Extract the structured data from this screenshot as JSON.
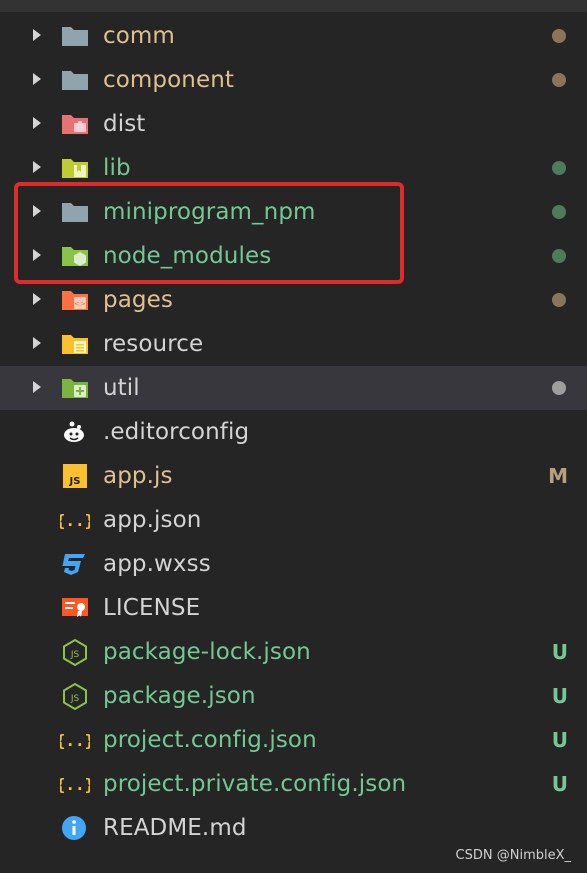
{
  "colors": {
    "background": "#252526",
    "modified": "#e2c08d",
    "untracked": "#73c991",
    "normal": "#d4d4d4",
    "highlight": "#e02b2b"
  },
  "explorer": {
    "folders": [
      {
        "name": "comm",
        "icon": "folder-icon",
        "status": "modified",
        "dot": "#8b7559"
      },
      {
        "name": "component",
        "icon": "folder-icon",
        "status": "modified",
        "dot": "#8b7559"
      },
      {
        "name": "dist",
        "icon": "folder-dist-icon",
        "status": "normal"
      },
      {
        "name": "lib",
        "icon": "folder-lib-icon",
        "status": "untracked",
        "dot": "#4c7c58"
      },
      {
        "name": "miniprogram_npm",
        "icon": "folder-icon",
        "status": "untracked",
        "dot": "#4c7c58"
      },
      {
        "name": "node_modules",
        "icon": "folder-node-icon",
        "status": "untracked",
        "dot": "#4c7c58"
      },
      {
        "name": "pages",
        "icon": "folder-pages-icon",
        "status": "modified",
        "dot": "#8b7559"
      },
      {
        "name": "resource",
        "icon": "folder-resource-icon",
        "status": "normal"
      },
      {
        "name": "util",
        "icon": "folder-util-icon",
        "status": "normal",
        "dot": "#9e9e9e",
        "selected": true
      }
    ],
    "files": [
      {
        "name": ".editorconfig",
        "icon": "editorconfig-icon",
        "status": "normal"
      },
      {
        "name": "app.js",
        "icon": "js-file-icon",
        "status": "modified",
        "badge": "M"
      },
      {
        "name": "app.json",
        "icon": "json-braces-icon",
        "status": "normal"
      },
      {
        "name": "app.wxss",
        "icon": "css-file-icon",
        "status": "normal"
      },
      {
        "name": "LICENSE",
        "icon": "license-icon",
        "status": "normal"
      },
      {
        "name": "package-lock.json",
        "icon": "nodejs-icon",
        "status": "untracked",
        "badge": "U"
      },
      {
        "name": "package.json",
        "icon": "nodejs-icon",
        "status": "untracked",
        "badge": "U"
      },
      {
        "name": "project.config.json",
        "icon": "json-braces-icon",
        "status": "untracked",
        "badge": "U"
      },
      {
        "name": "project.private.config.json",
        "icon": "json-braces-icon",
        "status": "untracked",
        "badge": "U"
      },
      {
        "name": "README.md",
        "icon": "info-icon",
        "status": "normal"
      }
    ]
  },
  "watermark": "CSDN @NimbleX_"
}
